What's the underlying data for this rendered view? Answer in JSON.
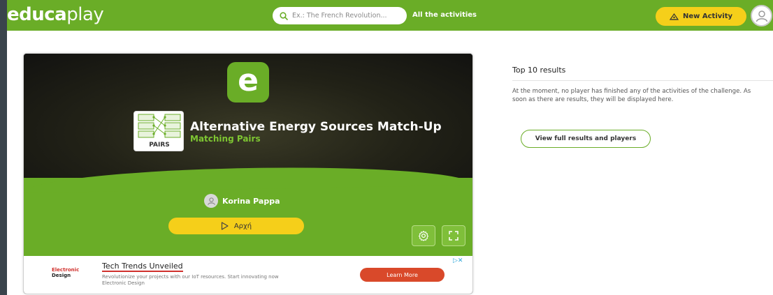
{
  "header": {
    "logo_bold": "educa",
    "logo_light": "play",
    "search_placeholder": "Ex.: The French Revolution...",
    "all_activities": "All the activities",
    "new_activity": "New Activity"
  },
  "game": {
    "title": "Alternative Energy Sources Match-Up",
    "subtitle": "Matching Pairs",
    "type_word": "PAIRS",
    "author": "Korina Pappa",
    "start_label": "Αρχή"
  },
  "ad": {
    "brand_line1": "Electronic",
    "brand_line2": "Design",
    "title": "Tech Trends Unveiled",
    "desc_line1": "Revolutionize your projects with our IoT resources. Start innovating now",
    "desc_line2": "Electronic Design",
    "cta": "Learn More"
  },
  "results": {
    "title": "Top 10 results",
    "message": "At the moment, no player has finished any of the activities of the challenge. As soon as there are results, they will be displayed here.",
    "button": "View full results and players"
  },
  "colors": {
    "brand_green": "#6aad27",
    "accent_yellow": "#f5cf1a",
    "ad_red": "#d9492a"
  }
}
